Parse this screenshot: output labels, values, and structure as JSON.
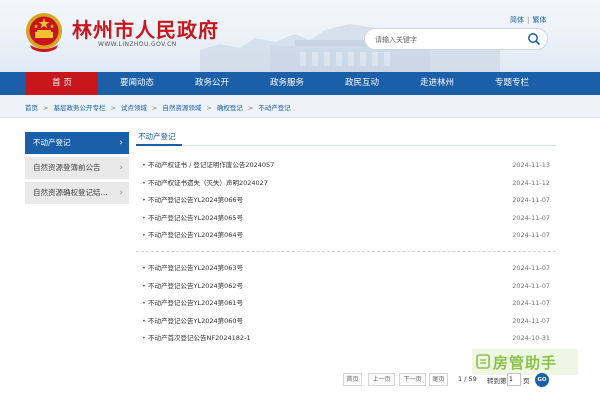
{
  "site": {
    "title": "林州市人民政府",
    "url": "WWW.LINZHOU.GOV.CN",
    "lang_simplified": "简体",
    "lang_separator": "|",
    "lang_traditional": "繁体"
  },
  "search": {
    "placeholder": "请输入关键字",
    "value": ""
  },
  "nav": {
    "items": [
      {
        "label": "首  页"
      },
      {
        "label": "要闻动态"
      },
      {
        "label": "政务公开"
      },
      {
        "label": "政务服务"
      },
      {
        "label": "政民互动"
      },
      {
        "label": "走进林州"
      },
      {
        "label": "专题专栏"
      }
    ],
    "active_index": 0
  },
  "breadcrumb": {
    "items": [
      "首页",
      "基层政务公开专栏",
      "试点领域",
      "自然资源领域",
      "确权登记",
      "不动产登记"
    ],
    "separator": ">"
  },
  "sidebar": {
    "items": [
      {
        "label": "不动产登记",
        "active": true
      },
      {
        "label": "自然资源登簿前公告",
        "active": false
      },
      {
        "label": "自然资源确权登记结...",
        "active": false
      }
    ]
  },
  "content": {
    "title": "不动产登记",
    "groups": [
      [
        {
          "title": "不动产权证书 / 登记证明作废公告2024057",
          "date": "2024-11-13"
        },
        {
          "title": "不动产权证书遗失（灭失）声明2024027",
          "date": "2024-11-12"
        },
        {
          "title": "不动产登记公告YL2024第066号",
          "date": "2024-11-07"
        },
        {
          "title": "不动产登记公告YL2024第065号",
          "date": "2024-11-07"
        },
        {
          "title": "不动产登记公告YL2024第064号",
          "date": "2024-11-07"
        }
      ],
      [
        {
          "title": "不动产登记公告YL2024第063号",
          "date": "2024-11-07"
        },
        {
          "title": "不动产登记公告YL2024第062号",
          "date": "2024-11-07"
        },
        {
          "title": "不动产登记公告YL2024第061号",
          "date": "2024-11-07"
        },
        {
          "title": "不动产登记公告YL2024第060号",
          "date": "2024-11-07"
        },
        {
          "title": "不动产首次登记公告NF2024182-1",
          "date": "2024-10-31"
        }
      ]
    ]
  },
  "pagination": {
    "first": "首页",
    "prev": "上一页",
    "next": "下一页",
    "last": "尾页",
    "current_page": "1",
    "total_pages": "59",
    "page_info_separator": "/",
    "jump_label": "转到第",
    "jump_suffix": "页",
    "jump_value": "1",
    "go": "GO"
  },
  "watermark": {
    "text": "房管助手"
  },
  "colors": {
    "brand_red": "#c8161d",
    "nav_blue": "#1a5fa8",
    "sidebar_inactive": "#e9e9e9",
    "watermark_green": "#8bc34a"
  },
  "icons": {
    "emblem": "national-emblem-icon",
    "search": "search-icon",
    "bullet": "bullet-dot",
    "chevron": "chevron-right-icon",
    "watermark": "house-helper-icon"
  }
}
